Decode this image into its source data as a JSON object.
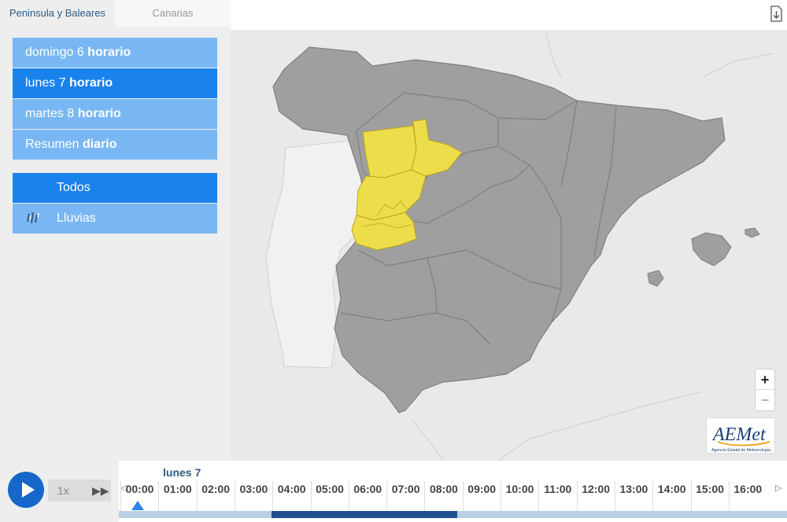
{
  "tabs": [
    {
      "label": "Peninsula y Baleares",
      "active": true
    },
    {
      "label": "Canarias",
      "active": false
    }
  ],
  "days": [
    {
      "day": "domingo 6",
      "mode": "horario",
      "selected": false
    },
    {
      "day": "lunes 7",
      "mode": "horario",
      "selected": true
    },
    {
      "day": "martes 8",
      "mode": "horario",
      "selected": false
    },
    {
      "day": "Resumen",
      "mode": "diario",
      "selected": false
    }
  ],
  "phenomena": [
    {
      "label": "Todos",
      "icon": "none",
      "selected": true
    },
    {
      "label": "Lluvias",
      "icon": "rain-icon",
      "selected": false
    }
  ],
  "map": {
    "zoom_in": "+",
    "zoom_out": "−",
    "logo_text": "AEMet",
    "logo_subtitle": "Agencia Estatal de Meteorología",
    "warning_color": "#eedd4a",
    "base_color": "#9f9f9f"
  },
  "timeline": {
    "day_label": "lunes 7",
    "speed": "1x",
    "hours": [
      "00:00",
      "01:00",
      "02:00",
      "03:00",
      "04:00",
      "05:00",
      "06:00",
      "07:00",
      "08:00",
      "09:00",
      "10:00",
      "11:00",
      "12:00",
      "13:00",
      "14:00",
      "15:00",
      "16:00"
    ],
    "current_hour_index": 0
  },
  "colors": {
    "button": "#79b7f4",
    "button_selected": "#1a82ec",
    "play": "#1667c9"
  }
}
